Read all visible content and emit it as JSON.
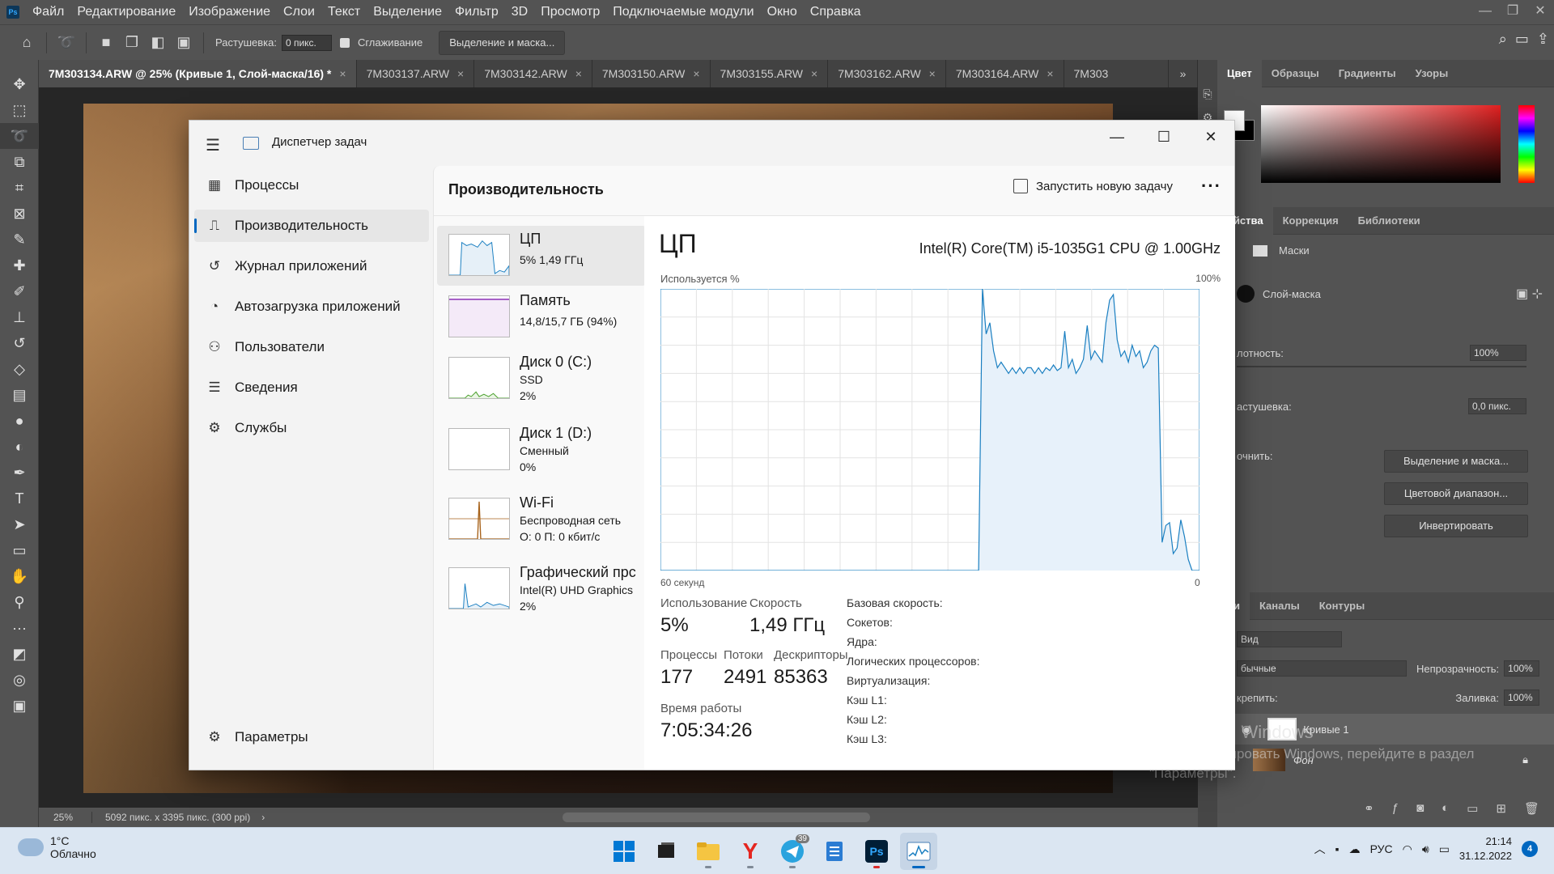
{
  "photoshop": {
    "logo": "Ps",
    "menu": [
      "Файл",
      "Редактирование",
      "Изображение",
      "Слои",
      "Текст",
      "Выделение",
      "Фильтр",
      "3D",
      "Просмотр",
      "Подключаемые модули",
      "Окно",
      "Справка"
    ],
    "options": {
      "feather_label": "Растушевка:",
      "feather_value": "0 пикс.",
      "antialias_label": "Сглаживание",
      "select_mask_button": "Выделение и маска..."
    },
    "tabs": [
      {
        "label": "7M303134.ARW @ 25% (Кривые 1, Слой-маска/16) *",
        "close": "×"
      },
      {
        "label": "7M303137.ARW",
        "close": "×"
      },
      {
        "label": "7M303142.ARW",
        "close": "×"
      },
      {
        "label": "7M303150.ARW",
        "close": "×"
      },
      {
        "label": "7M303155.ARW",
        "close": "×"
      },
      {
        "label": "7M303162.ARW",
        "close": "×"
      },
      {
        "label": "7M303164.ARW",
        "close": "×"
      },
      {
        "label": "7M303",
        "close": ""
      }
    ],
    "tabs_overflow": "»",
    "status": {
      "zoom": "25%",
      "dims": "5092 пикс. x 3395 пикс. (300 ppi)",
      "arrow": "›"
    },
    "panels": {
      "color_tabs": [
        "Цвет",
        "Образцы",
        "Градиенты",
        "Узоры"
      ],
      "props_tabs": [
        "ойства",
        "Коррекция",
        "Библиотеки"
      ],
      "masks_label": "Маски",
      "layer_mask_label": "Слой-маска",
      "density_label": "лотность:",
      "density_value": "100%",
      "feather_label": "астушевка:",
      "feather_value": "0,0 пикс.",
      "refine_label": "очнить:",
      "btn_select_mask": "Выделение и маска...",
      "btn_color_range": "Цветовой диапазон...",
      "btn_invert": "Инвертировать",
      "layers_tabs": [
        "ои",
        "Каналы",
        "Контуры"
      ],
      "kind_label": "Вид",
      "blend_mode": "бычные",
      "opacity_label": "Непрозрачность:",
      "opacity_value": "100%",
      "lock_label": "крепить:",
      "fill_label": "Заливка:",
      "fill_value": "100%",
      "layers": [
        {
          "name": "Кривые 1"
        },
        {
          "name": "Фон"
        }
      ]
    },
    "activation": {
      "title": "Активация Windows",
      "sub1": "Чтобы активировать Windows, перейдите в раздел",
      "sub2": "\"Параметры\"."
    }
  },
  "task_manager": {
    "title": "Диспетчер задач",
    "nav": [
      {
        "label": "Процессы",
        "icon": "processes-icon"
      },
      {
        "label": "Производительность",
        "icon": "performance-icon",
        "active": true
      },
      {
        "label": "Журнал приложений",
        "icon": "history-icon"
      },
      {
        "label": "Автозагрузка приложений",
        "icon": "startup-icon"
      },
      {
        "label": "Пользователи",
        "icon": "users-icon"
      },
      {
        "label": "Сведения",
        "icon": "details-icon"
      },
      {
        "label": "Службы",
        "icon": "services-icon"
      }
    ],
    "settings_label": "Параметры",
    "page_title": "Производительность",
    "new_task_label": "Запустить новую задачу",
    "more": "···",
    "resources": [
      {
        "name": "ЦП",
        "line1": "5%  1,49 ГГц",
        "line2": "",
        "color": "#1a7fc1"
      },
      {
        "name": "Память",
        "line1": "14,8/15,7 ГБ (94%)",
        "line2": "",
        "color": "#8b2fb4"
      },
      {
        "name": "Диск 0 (C:)",
        "line1": "SSD",
        "line2": "2%",
        "color": "#4aa02c"
      },
      {
        "name": "Диск 1 (D:)",
        "line1": "Сменный",
        "line2": "0%",
        "color": "#4aa02c"
      },
      {
        "name": "Wi-Fi",
        "line1": "Беспроводная сеть",
        "line2": "О: 0 П: 0 кбит/с",
        "color": "#a7621a"
      },
      {
        "name": "Графический прс",
        "line1": "Intel(R) UHD Graphics",
        "line2": "2%",
        "color": "#1a7fc1"
      }
    ],
    "cpu": {
      "title": "ЦП",
      "model": "Intel(R) Core(TM) i5-1035G1 CPU @ 1.00GHz",
      "util_label": "Используется %",
      "util_max": "100%",
      "time_left": "60 секунд",
      "time_right": "0",
      "stats": {
        "usage_label": "Использование",
        "usage_value": "5%",
        "speed_label": "Скорость",
        "speed_value": "1,49 ГГц",
        "processes_label": "Процессы",
        "processes_value": "177",
        "threads_label": "Потоки",
        "threads_value": "2491",
        "handles_label": "Дескрипторы",
        "handles_value": "85363",
        "uptime_label": "Время работы",
        "uptime_value": "7:05:34:26"
      },
      "specs": [
        "Базовая скорость:",
        "Сокетов:",
        "Ядра:",
        "Логических процессоров:",
        "Виртуализация:",
        "Кэш L1:",
        "Кэш L2:",
        "Кэш L3:"
      ]
    }
  },
  "chart_data": {
    "type": "area",
    "title": "ЦП",
    "ylabel": "Используется %",
    "xlabel": "",
    "x_range_label": [
      "60 секунд",
      "0"
    ],
    "ylim": [
      0,
      100
    ],
    "grid": true,
    "series": [
      {
        "values": [
          0,
          0,
          0,
          0,
          0,
          0,
          0,
          0,
          0,
          0,
          0,
          0,
          0,
          0,
          0,
          0,
          0,
          0,
          0,
          0,
          0,
          0,
          0,
          0,
          0,
          0,
          0,
          0,
          0,
          0,
          0,
          0,
          0,
          0,
          0,
          0,
          0,
          0,
          0,
          0,
          0,
          0,
          0,
          0,
          0,
          0,
          0,
          0,
          0,
          0,
          0,
          0,
          0,
          0,
          0,
          0,
          0,
          0,
          0,
          0,
          0,
          0,
          0,
          0,
          0,
          0,
          0,
          0,
          0,
          0,
          0,
          0,
          0,
          0,
          0,
          0,
          0,
          0,
          0,
          0,
          0,
          0,
          0,
          0,
          0,
          0,
          100,
          84,
          88,
          78,
          72,
          74,
          72,
          70,
          72,
          70,
          72,
          70,
          72,
          72,
          70,
          72,
          70,
          72,
          71,
          73,
          71,
          72,
          85,
          72,
          75,
          70,
          72,
          75,
          87,
          75,
          78,
          76,
          74,
          88,
          96,
          98,
          82,
          76,
          78,
          74,
          80,
          76,
          78,
          72,
          74,
          78,
          80,
          79,
          10,
          16,
          17,
          6,
          8,
          18,
          12,
          4,
          0,
          0,
          0
        ]
      }
    ]
  },
  "taskbar": {
    "weather_temp": "1°C",
    "weather_desc": "Облачно",
    "apps": [
      {
        "name": "start-icon"
      },
      {
        "name": "task-view-icon"
      },
      {
        "name": "file-explorer-icon"
      },
      {
        "name": "yandex-browser-icon"
      },
      {
        "name": "telegram-icon",
        "badge": "39"
      },
      {
        "name": "notepad-icon"
      },
      {
        "name": "photoshop-icon",
        "label": "Ps"
      },
      {
        "name": "task-manager-icon"
      }
    ],
    "lang": "РУС",
    "time": "21:14",
    "date": "31.12.2022",
    "notifications": "4"
  }
}
